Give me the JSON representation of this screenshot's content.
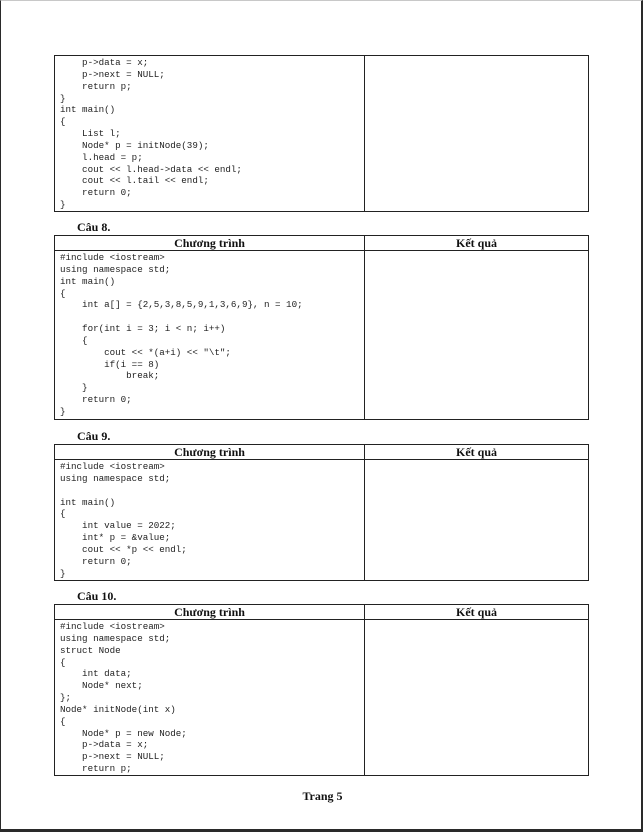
{
  "top_block": {
    "code_lines": [
      "    p->data = x;",
      "    p->next = NULL;",
      "    return p;",
      "}",
      "int main()",
      "{",
      "    List l;",
      "    Node* p = initNode(39);",
      "    l.head = p;",
      "    cout << l.head->data << endl;",
      "    cout << l.tail << endl;",
      "    return 0;",
      "}"
    ]
  },
  "headers": {
    "program": "Chương trình",
    "result": "Kết quả"
  },
  "questions": [
    {
      "title": "Câu 8.",
      "code_lines": [
        "#include <iostream>",
        "using namespace std;",
        "int main()",
        "{",
        "    int a[] = {2,5,3,8,5,9,1,3,6,9}, n = 10;",
        "",
        "    for(int i = 3; i < n; i++)",
        "    {",
        "        cout << *(a+i) << \"\\t\";",
        "        if(i == 8)",
        "            break;",
        "    }",
        "    return 0;",
        "}"
      ]
    },
    {
      "title": "Câu 9.",
      "code_lines": [
        "#include <iostream>",
        "using namespace std;",
        "",
        "int main()",
        "{",
        "    int value = 2022;",
        "    int* p = &value;",
        "    cout << *p << endl;",
        "    return 0;",
        "}"
      ]
    },
    {
      "title": "Câu 10.",
      "code_lines": [
        "#include <iostream>",
        "using namespace std;",
        "struct Node",
        "{",
        "    int data;",
        "    Node* next;",
        "};",
        "Node* initNode(int x)",
        "{",
        "    Node* p = new Node;",
        "    p->data = x;",
        "    p->next = NULL;",
        "    return p;"
      ]
    }
  ],
  "footer": "Trang 5"
}
